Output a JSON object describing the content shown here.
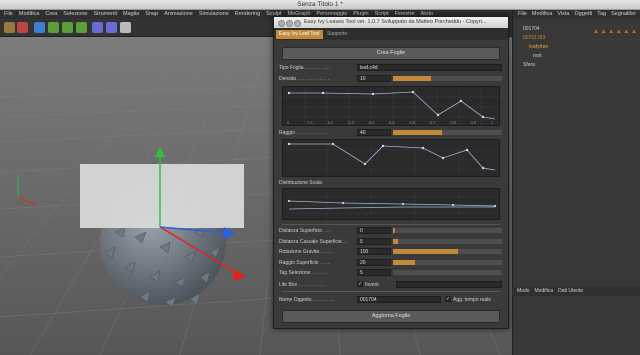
{
  "window": {
    "title": "Senza Titolo 1 *"
  },
  "menu": [
    "File",
    "Modifica",
    "Crea",
    "Selezione",
    "Strumenti",
    "Maglia",
    "Snap",
    "Animazione",
    "Simulazione",
    "Rendering",
    "Sculpt",
    "MoGraph",
    "Personaggio",
    "Plugin",
    "Script",
    "Finestre",
    "Aiuto"
  ],
  "object_manager": {
    "menu": [
      "File",
      "Modifica",
      "Vista",
      "Oggetti",
      "Tag",
      "Segnalibri"
    ],
    "rows": [
      {
        "name": "001704"
      },
      {
        "name": "00701783"
      },
      {
        "name": "leafytree"
      },
      {
        "name": "root"
      },
      {
        "name": "Sfera"
      }
    ]
  },
  "attribute_manager": {
    "menu": [
      "Modo",
      "Modifica",
      "Dati Utente"
    ]
  },
  "dialog": {
    "title": "Easy Ivy Leaves Tool ver. 1.0.7 Sviluppato da Matteo Porcheddu - Copyri...",
    "tabs": [
      "Easy Ivy Leaf Tool",
      "Supporto"
    ],
    "create_button": "Crea Foglie",
    "tipo_foglia": {
      "label": "Tipo Foglia . . . . . . . . . .",
      "value": "leaf.c4d"
    },
    "densita": {
      "label": "Densita . . . . . . . . . . . .",
      "value": "10",
      "fill": 0.35
    },
    "raggio": {
      "label": "Raggio . . . . . . . . . . . .",
      "value": "40",
      "fill": 0.45
    },
    "distribuzione": {
      "label": "Distribuzione Scala"
    },
    "graph_ticks": [
      "0",
      "0.1",
      "0.2",
      "0.3",
      "0.4",
      "0.5",
      "0.6",
      "0.7",
      "0.8",
      "0.9",
      "1"
    ],
    "params": [
      {
        "key": "dist_sup",
        "label": "Distanza Superficie . . .",
        "value": "0",
        "fill": 0.02
      },
      {
        "key": "dist_cas",
        "label": "Distanza Casuale Superficie . .",
        "value": "5",
        "fill": 0.05
      },
      {
        "key": "rot_grav",
        "label": "Rotazione Gravita . . . . .",
        "value": "100",
        "fill": 0.6
      },
      {
        "key": "raggio_sup",
        "label": "Raggio Superficie . . . .",
        "value": "20",
        "fill": 0.2
      },
      {
        "key": "tag_sel",
        "label": "Tag Selezione . . . . . .",
        "value": "5",
        "fill": 0.0
      }
    ],
    "life_box": {
      "label": "Life Box . . . . . . . . . .",
      "check_label": "Inverti"
    },
    "nome_oggetto": {
      "label": "Nome Oggetto . . . . . . . .",
      "value": "001704",
      "check_label": "Agg. tempo reale"
    },
    "update_button": "Aggiorna Foglie"
  },
  "colors": {
    "accent": "#c28a3a",
    "axis_y": "#2bc43a",
    "axis_x": "#e3241b",
    "axis_z": "#2c5fe0"
  }
}
